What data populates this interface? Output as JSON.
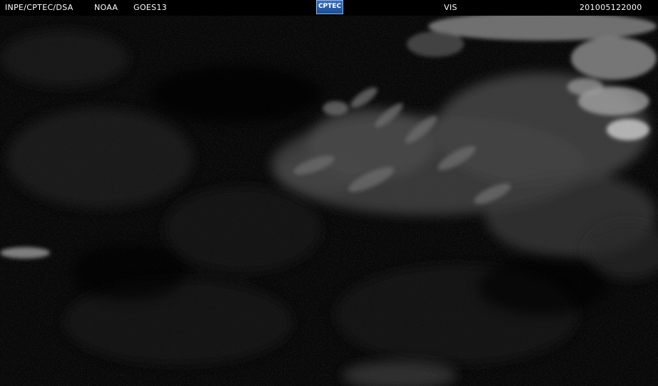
{
  "header": {
    "agency": "INPE/CPTEC/DSA",
    "operator": "NOAA",
    "satellite": "GOES13",
    "logo_text": "CPTEC",
    "channel": "VIS",
    "timestamp": "201005122000"
  },
  "colors": {
    "background": "#000000",
    "header_text": "#ffffff",
    "logo_blue": "#2a5ea6"
  }
}
